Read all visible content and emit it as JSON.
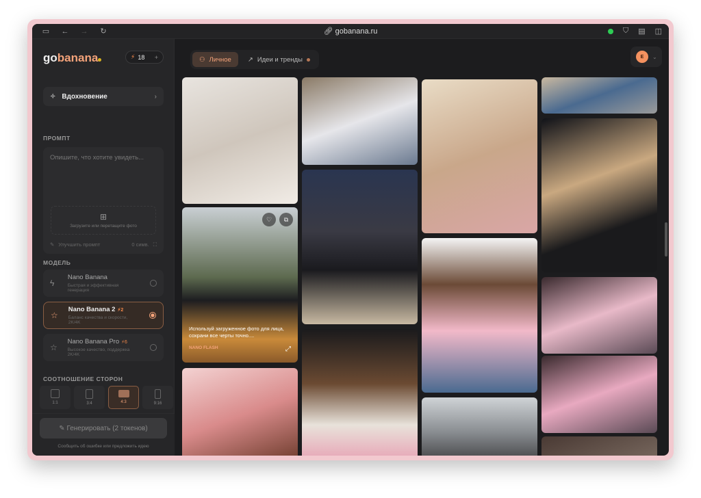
{
  "browser": {
    "url": "gobanana.ru"
  },
  "sidebar": {
    "logo": {
      "go": "go",
      "banana": "banana"
    },
    "tokens": "18",
    "add": "+",
    "inspiration": "Вдохновение",
    "prompt_label": "ПРОМПТ",
    "prompt_placeholder": "Опишите, что хотите увидеть...",
    "upload": "Загрузите или перетащите фото",
    "improve": "Улучшить промпт",
    "chars": "0 симв.",
    "model_label": "МОДЕЛЬ",
    "models": [
      {
        "name": "Nano Banana",
        "cost": "",
        "desc": "Быстрая и эффективная генерация",
        "selected": false,
        "icon": "lightning-icon"
      },
      {
        "name": "Nano Banana 2",
        "cost": "2",
        "desc": "Баланс качества и скорости, 2K/4K",
        "selected": true,
        "icon": "star-icon"
      },
      {
        "name": "Nano Banana Pro",
        "cost": "6",
        "desc": "Высокое качество, поддержка 2K/4K",
        "selected": false,
        "icon": "star-icon"
      }
    ],
    "aspect_label": "СООТНОШЕНИЕ СТОРОН",
    "aspects": [
      "1:1",
      "3:4",
      "4:3",
      "9:16"
    ],
    "aspect_selected": "4:3",
    "generate": "Генерировать (2 токенов)",
    "report": "Сообщить об ошибке или предложить идею"
  },
  "main": {
    "tabs": [
      {
        "label": "Личное",
        "active": true
      },
      {
        "label": "Идеи и тренды",
        "active": false
      }
    ],
    "user_initial": "E",
    "featured_caption": "Используй загруженное фото для лица, сохрани все черты точно....",
    "featured_model": "NANO FLASH"
  },
  "colors": {
    "accent": "#f4a37a",
    "bg": "#1c1c1e",
    "sidebar": "#262628"
  }
}
